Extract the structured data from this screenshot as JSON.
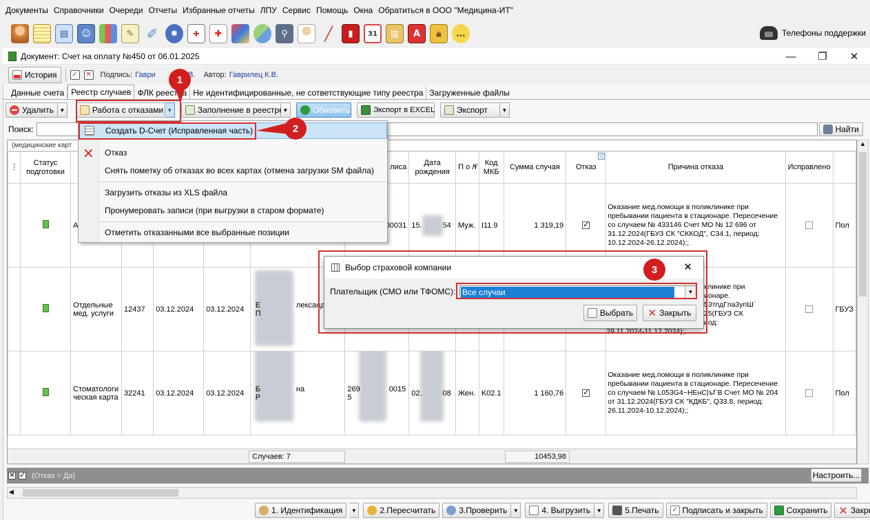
{
  "menubar": {
    "items": [
      "Документы",
      "Справочники",
      "Очереди",
      "Отчеты",
      "Избранные отчеты",
      "ЛПУ",
      "Сервис",
      "Помощь",
      "Окна",
      "Обратиться в ООО \"Медицина-ИТ\""
    ]
  },
  "toolbar_icons": [
    "doctor-icon",
    "notepad-icon",
    "patient-card-icon",
    "id-card-icon",
    "lab-flasks-icon",
    "notebook-icon",
    "syringe-icon",
    "medal-icon",
    "report-icon",
    "first-aid-kit-icon",
    "medical-bag-icon",
    "tablets-icon",
    "microscope-icon",
    "nurse-icon",
    "thermometer-icon",
    "red-book-icon",
    "calendar-icon",
    "cabinet-icon",
    "document-icon",
    "padlock-icon",
    "chat-bubble-icon"
  ],
  "support": {
    "label": "Телефоны поддержки"
  },
  "document": {
    "title": "Документ: Счет на оплату №450 от 06.01.2025",
    "history_label": "История",
    "signature_prefix": "Подпись:",
    "signature_value": "Гаври",
    "signature_value_tail": "К.В.",
    "author_prefix": "Автор:",
    "author_value": "Гаврилец К.В."
  },
  "tabs": [
    "Данные счета",
    "Реестр случаев",
    "ФЛК реестра",
    "Не идентифицированные, не сответствующие типу реестра",
    "Загруженные файлы"
  ],
  "actions": {
    "delete": "Удалить",
    "rejections": "Работа с отказами",
    "fill_registry": "Заполнение в реестре",
    "refresh": "Обновить",
    "export_excel": "Экспорт в EXCEL",
    "export": "Экспорт"
  },
  "search": {
    "label": "Поиск:",
    "value": "",
    "find_button": "Найти"
  },
  "grid": {
    "group_caption": "(медицинские карт",
    "headers": {
      "status": "Статус подготовки",
      "type": "Ви",
      "policy": "лиса",
      "birth": "Дата рождения",
      "sex": "П о л",
      "mkb": "Код МКБ",
      "sum": "Сумма случая",
      "refusal": "Отказ",
      "reason": "Причина отказа",
      "fixed": "Исправлено"
    },
    "rows": [
      {
        "type": "Амб й т",
        "number": "",
        "date_start": "",
        "date_end": "",
        "patient": "",
        "policy_tail": "00031",
        "birth_prefix": "15.",
        "birth_suffix": "54",
        "sex": "Муж.",
        "mkb": "I11.9",
        "sum": "1 319,19",
        "refusal": true,
        "reason": "Оказание мед.помощи в поликлинике при пребывании пациента в стационаре. Пересечение со случаем № 433146 Счет МО № 12 696 от 31.12.2024(ГБУЗ СК \"СККОД\", С34.1, период: 10.12.2024-26.12.2024);;",
        "fixed": false,
        "last": "Пол"
      },
      {
        "type": "Отдельные мед. услуги",
        "number": "12437",
        "date_start": "03.12.2024",
        "date_end": "03.12.2024",
        "patient_prefix": "Е",
        "patient_suffix": "лександ",
        "patient_line2": "П",
        "reason_1": "ликлинике при",
        "reason_2": "ационаре.",
        "reason_3": "L053тпдГпа3упШ`",
        "reason_4": "2025(ГБУЗ СК",
        "reason_5": "ериод:",
        "reason_6": "29.11.2024-11.12.2024);;",
        "fixed": false,
        "last": "ГБУЗ"
      },
      {
        "type": "Стоматологи ческая карта",
        "number": "32241",
        "date_start": "03.12.2024",
        "date_end": "03.12.2024",
        "patient_prefix": "Б",
        "patient_suffix": "на",
        "patient_line2": "Р",
        "policy_prefix": "269",
        "policy_tail": "0015",
        "policy_line2": "5",
        "birth_prefix": "02.",
        "birth_suffix": "08",
        "sex": "Жен.",
        "mkb": "K02.1",
        "sum": "1 160,76",
        "refusal": true,
        "reason": "Оказание мед.помощи в поликлинике при пребывании пациента в стационаре. Пересечение со случаем № L053G4~HEнС|ъf`B Счет МО № 204 от 31.12.2024(ГБУЗ СК \"КДКБ\", Q33.8, период: 26.11.2024-10.12.2024);;",
        "fixed": false,
        "last": "Пол"
      }
    ],
    "footer_count": "Случаев: 7",
    "footer_sum": "10453,98"
  },
  "dropdown_menu": {
    "items": [
      "Создать D-Счет (Исправленная часть)",
      "Отказ",
      "Снять пометку об отказах во всех картах (отмена загрузки SM файла)",
      "Загрузить отказы из XLS файла",
      "Пронумеровать записи (при выгрузки в старом формате)",
      "Отметить отказанными все выбранные позиции"
    ]
  },
  "dialog": {
    "title": "Выбор страховой компании",
    "payer_label": "Плательщик (СМО или ТФОМС):",
    "payer_value": "Все случаи",
    "choose": "Выбрать",
    "close": "Закрыть"
  },
  "callouts": [
    "1",
    "2",
    "3"
  ],
  "filter": {
    "text": "(Отказ = Да)",
    "configure": "Настроить..."
  },
  "bottom": {
    "identify": "1. Идентификация",
    "recalc": "2.Пересчитать",
    "check": "3.Проверить",
    "upload": "4. Выгрузить",
    "print": "5.Печать",
    "sign_close": "Подписать и закрыть",
    "save": "Сохранить",
    "close": "Закрыть"
  },
  "colors": {
    "accent_red": "#d11f1f",
    "selection_blue": "#1e7fd6",
    "menu_highlight": "#cce4f7"
  }
}
